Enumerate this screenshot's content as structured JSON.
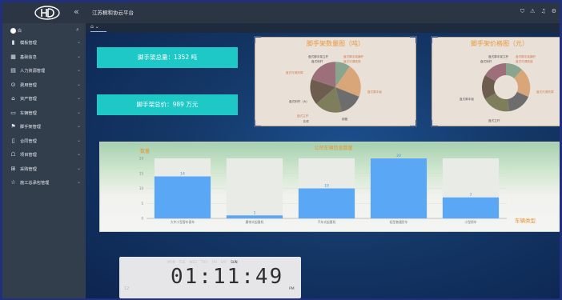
{
  "header": {
    "title": "江苏桐和协云平台",
    "collapse_icon": "«",
    "icons": [
      "shield-icon",
      "alert-icon",
      "bell-icon",
      "settings-icon"
    ]
  },
  "sidebar": {
    "user": "白",
    "items": [
      {
        "label": "模板管理",
        "icon": "file-icon"
      },
      {
        "label": "基础信息",
        "icon": "grid-icon"
      },
      {
        "label": "人力资源管理",
        "icon": "calendar-icon"
      },
      {
        "label": "费用管理",
        "icon": "money-icon"
      },
      {
        "label": "资产管理",
        "icon": "asset-icon"
      },
      {
        "label": "车辆管理",
        "icon": "truck-icon"
      },
      {
        "label": "脚手架管理",
        "icon": "flag-icon"
      },
      {
        "label": "合同管理",
        "icon": "document-icon"
      },
      {
        "label": "项目管理",
        "icon": "project-icon"
      },
      {
        "label": "采购管理",
        "icon": "purchase-icon"
      },
      {
        "label": "施工总承包管理",
        "icon": "star-icon"
      }
    ]
  },
  "tabs": {
    "home": "⌂ ⌄"
  },
  "stats": [
    {
      "label": "脚手架总量：",
      "value": "1352 吨"
    },
    {
      "label": "脚手架总价：",
      "value": "989 万元"
    }
  ],
  "pie_quantity": {
    "title": "脚手架数量图（吨）",
    "labels": [
      "盘式脚手架立杆",
      "盘式脚手架横杆",
      "盘式斜杆",
      "盘式可调底座",
      "盘式可调托撑",
      "盘式脚手板",
      "盘式斜杆（大）",
      "盘式立杆",
      "钢管",
      "扣件"
    ],
    "colors": [
      "#8aa58d",
      "#d9a679",
      "#6d6d6d",
      "#7e7e5c",
      "#6d5d4e",
      "#9c6f7a",
      "#b5a48a",
      "#c4b79c"
    ]
  },
  "pie_value": {
    "title": "脚手架价格图（元）",
    "labels": [
      "盘式脚手架立杆",
      "盘式脚手架横杆",
      "盘式斜杆",
      "盘式可调底座",
      "盘式可调托撑",
      "盘式脚手板",
      "盘式立杆"
    ],
    "colors": [
      "#8aa58d",
      "#d9a679",
      "#6d6d6d",
      "#7e7e5c",
      "#6d5d4e",
      "#9c6f7a"
    ]
  },
  "chart_data": {
    "type": "bar",
    "title": "公司车辆信息数量",
    "ylabel": "数量",
    "xlabel": "车辆类型",
    "categories": [
      "大中小型客车客车",
      "履带式起重机",
      "汽车式起重机",
      "轻型普通货车",
      "小型轿车"
    ],
    "values": [
      14,
      1,
      10,
      20,
      7
    ],
    "ylim": [
      0,
      20
    ],
    "yticks": [
      0,
      5,
      10,
      15,
      20
    ],
    "bar_color": "#5aa7f5",
    "bg_bar_color": "#e9ebe7"
  },
  "clock": {
    "days": [
      "MON",
      "TUE",
      "WED",
      "THU",
      "FRI",
      "SAT",
      "SUN"
    ],
    "active_day": "SUN",
    "time": "01:11:49",
    "date": "12",
    "ampm": "PM"
  }
}
